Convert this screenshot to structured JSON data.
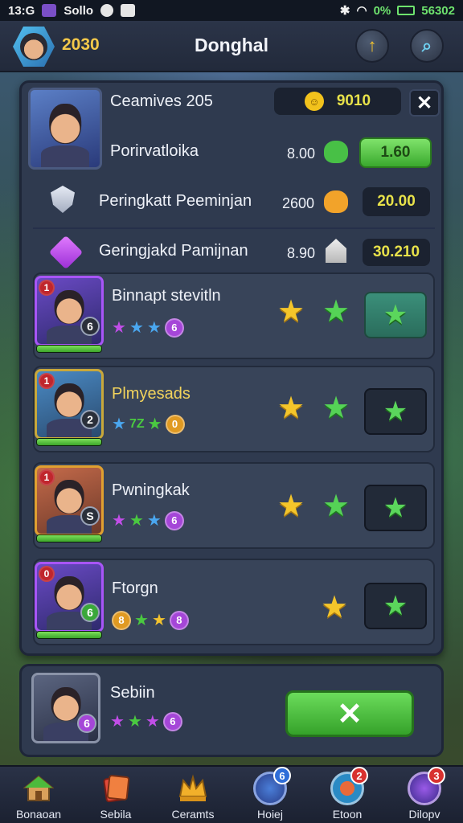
{
  "status_bar": {
    "time": "13:G",
    "app_label": "Sollo",
    "right_text": "0%",
    "right_time": "56302",
    "colors": {
      "bg": "#111722",
      "battery": "#6ee36e"
    }
  },
  "top_bar": {
    "coins": "2030",
    "title": "Donghal",
    "up_icon": "arrow-up-icon",
    "search_icon": "search-icon"
  },
  "summary": {
    "player_name": "Ceamives 205",
    "currency": "9010",
    "rows": [
      {
        "label": "Porirvatloika",
        "value": "8.00",
        "button": "1.60",
        "icon": "green-blob-icon"
      },
      {
        "label": "Peringkatt Peeminjan",
        "value": "2600",
        "button": "20.00",
        "icon": "orange-blob-icon"
      },
      {
        "label": "Geringjakd Pamijnan",
        "value": "8.90",
        "button": "30.210",
        "icon": "house-icon"
      }
    ]
  },
  "characters": [
    {
      "name": "Binnapt stevitln",
      "badge": "1",
      "level_text": "6",
      "hp": 1.0
    },
    {
      "name": "Plmyesads",
      "badge": "1",
      "level_text": "0",
      "hp": 1.0,
      "mini_text": "7Z"
    },
    {
      "name": "Pwningkak",
      "badge": "1",
      "level_text": "6",
      "hp": 1.0
    },
    {
      "name": "Ftorgn",
      "badge": "0",
      "level_text": "8",
      "left_level": "8",
      "hp": 1.0
    }
  ],
  "bottom_card": {
    "name": "Sebiin",
    "level_text": "6"
  },
  "bottom_nav": [
    {
      "label": "Bonaoan",
      "icon": "house-icon"
    },
    {
      "label": "Sebila",
      "icon": "cards-icon",
      "badge": ""
    },
    {
      "label": "Ceramts",
      "icon": "crown-icon"
    },
    {
      "label": "Hoiej",
      "icon": "shield-emblem-icon",
      "badge": "6"
    },
    {
      "label": "Etoon",
      "icon": "compass-icon",
      "badge": "2"
    },
    {
      "label": "Dilopv",
      "icon": "portal-icon",
      "badge": "3"
    }
  ]
}
